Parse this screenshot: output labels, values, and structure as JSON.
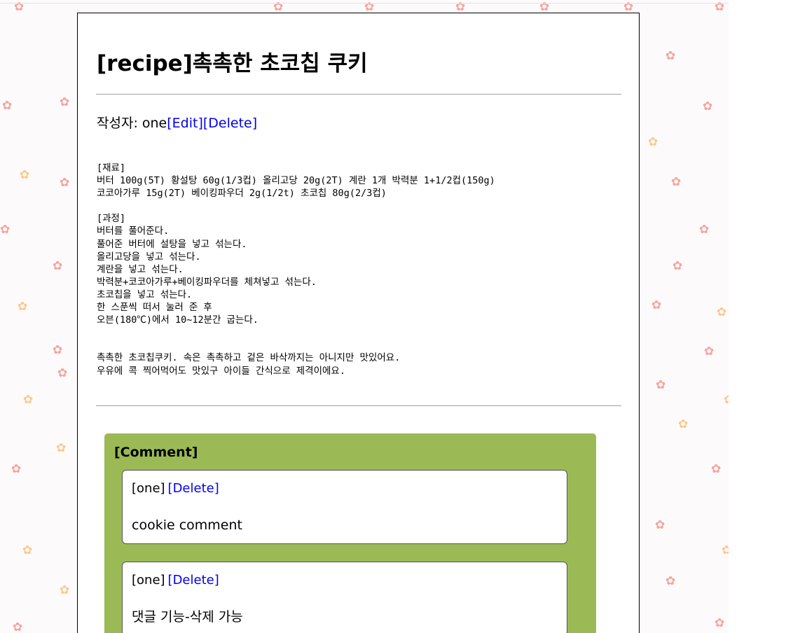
{
  "post": {
    "title": "[recipe]촉촉한 초코칩 쿠키",
    "author_label": "작성자: ",
    "author": "one",
    "edit_link": "[Edit]",
    "delete_link": "[Delete]",
    "content": "[재료]\n버터 100g(5T) 황설탕 60g(1/3컵) 올리고당 20g(2T) 계란 1개 박력분 1+1/2컵(150g)\n코코아가루 15g(2T) 베이킹파우더 2g(1/2t) 초코칩 80g(2/3컵)\n\n[과정]\n버터를 풀어준다.\n풀어준 버터에 설탕을 넣고 섞는다.\n올리고당을 넣고 섞는다.\n계란을 넣고 섞는다.\n박력분+코코아가루+베이킹파우더를 체쳐넣고 섞는다.\n초코칩을 넣고 섞는다.\n한 스푼씩 떠서 눌러 준 후\n오븐(180℃)에서 10~12분간 굽는다.\n\n\n촉촉한 초코칩쿠키. 속은 촉촉하고 겉은 바삭까지는 아니지만 맛있어요.\n우유에 콕 찍어먹어도 맛있구 아이들 간식으로 제격이에요."
  },
  "comments": {
    "header": "[Comment]",
    "items": [
      {
        "author": "[one]",
        "delete_label": "[Delete]",
        "text": "cookie comment"
      },
      {
        "author": "[one]",
        "delete_label": "[Delete]",
        "text": "댓글 기능-삭제 가능"
      }
    ]
  },
  "background": {
    "pattern_icon": "maple-leaf-icon",
    "colors": [
      "#f4a3a0",
      "#fbc98d"
    ]
  }
}
